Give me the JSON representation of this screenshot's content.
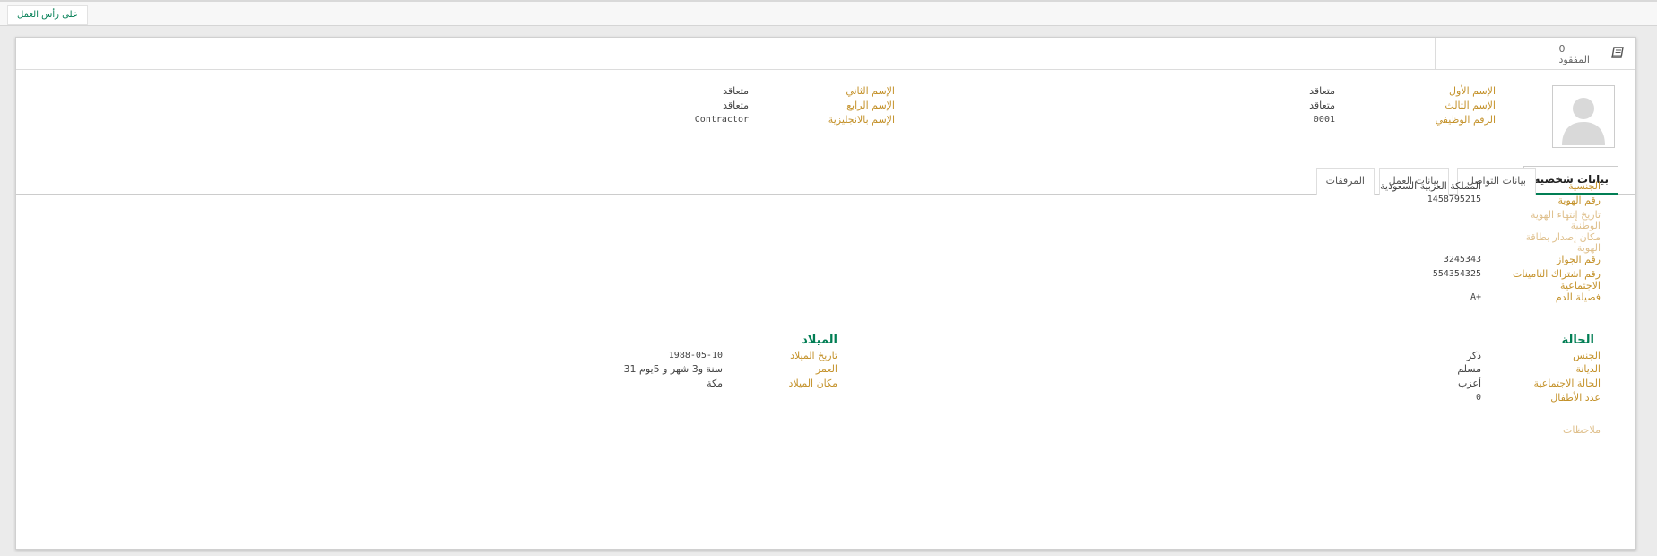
{
  "header": {
    "status_chip": "على رأس العمل"
  },
  "stat_button": {
    "value": "0",
    "label": "المفقود",
    "icon": "book-icon"
  },
  "names": {
    "first_label": "الإسم الأول",
    "first_value": "متعاقد",
    "second_label": "الإسم الثاني",
    "second_value": "متعاقد",
    "third_label": "الإسم الثالث",
    "third_value": "متعاقد",
    "fourth_label": "الإسم الرابع",
    "fourth_value": "متعاقد",
    "job_no_label": "الرقم الوظيفي",
    "job_no_value": "0001",
    "english_label": "الإسم بالانجليزية",
    "english_value": "Contractor"
  },
  "tabs": [
    {
      "label": "بيانات شخصية",
      "active": true
    },
    {
      "label": "بيانات التواصل",
      "active": false
    },
    {
      "label": "بيانات العمل",
      "active": false
    },
    {
      "label": "المرفقات",
      "active": false
    }
  ],
  "personal": {
    "nationality_label": "الجنسية",
    "nationality_value": "المملكة العربية السعودية",
    "id_label": "رقم الهوية",
    "id_value": "1458795215",
    "id_expiry_label_1": "تاريخ إنتهاء الهوية",
    "id_expiry_label_2": "الوطنية",
    "id_place_label_1": "مكان إصدار بطاقة",
    "id_place_label_2": "الهوية",
    "passport_label": "رقم الجواز",
    "passport_value": "3245343",
    "gosi_label_1": "رقم اشتراك التامينات",
    "gosi_label_2": "الاجتماعية",
    "gosi_value": "554354325",
    "blood_label": "فصيلة الدم",
    "blood_value": "A+"
  },
  "status_section": {
    "title": "الحالة",
    "gender_label": "الجنس",
    "gender_value": "ذكر",
    "religion_label": "الديانة",
    "religion_value": "مسلم",
    "marital_label": "الحالة الاجتماعية",
    "marital_value": "أعزب",
    "children_label": "عدد الأطفال",
    "children_value": "0"
  },
  "birth_section": {
    "title": "الميلاد",
    "date_label": "تاريخ الميلاد",
    "date_value": "1988-05-10",
    "age_label": "العمر",
    "age_value": "31 سنة و3 شهر و 5يوم",
    "place_label": "مكان الميلاد",
    "place_value": "مكة"
  },
  "notes_label": "ملاحظات",
  "colors": {
    "accent": "#017e54",
    "label": "#c4922b",
    "label_faint": "#dfc08d"
  }
}
